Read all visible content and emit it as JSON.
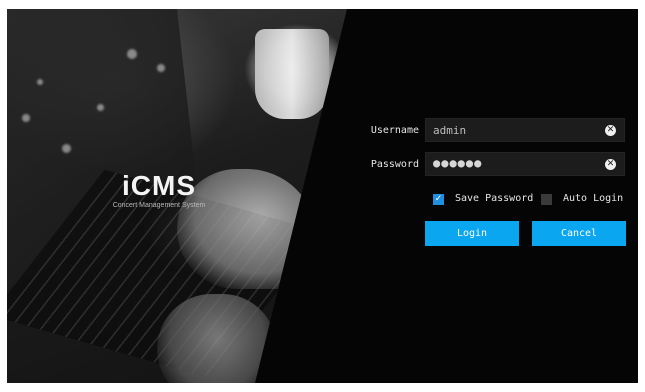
{
  "brand": {
    "title": "iCMS",
    "subtitle": "Concert Management System"
  },
  "login": {
    "username_label": "Username",
    "username_value": "admin",
    "password_label": "Password",
    "password_mask": "●●●●●●",
    "save_password_label": "Save Password",
    "save_password_checked": true,
    "auto_login_label": "Auto Login",
    "auto_login_checked": false,
    "login_button": "Login",
    "cancel_button": "Cancel",
    "clear_glyph": "✕"
  },
  "colors": {
    "accent": "#0aa6ef",
    "checkbox": "#1f8fe0",
    "background": "#050505"
  }
}
